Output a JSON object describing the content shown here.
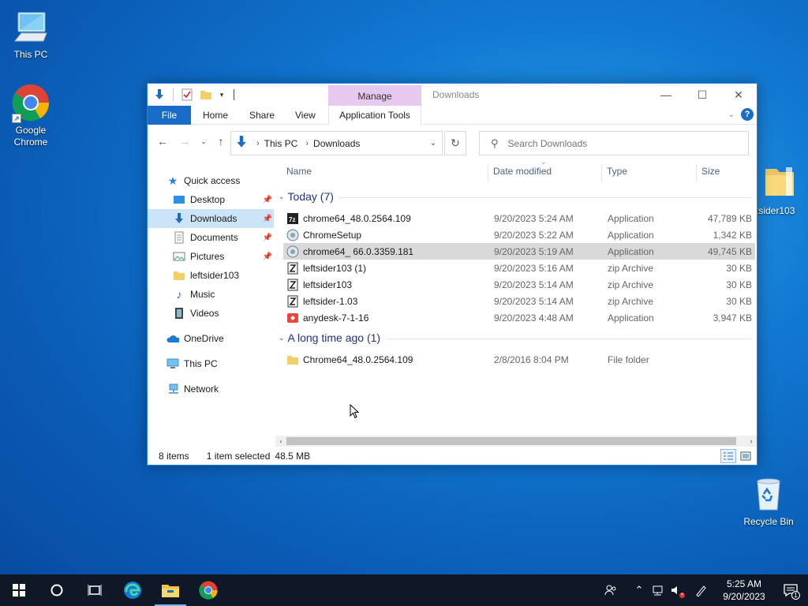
{
  "desktop": {
    "icons": [
      {
        "label": "This PC"
      },
      {
        "label": "Google Chrome"
      },
      {
        "label": "tsider103"
      },
      {
        "label": "Recycle Bin"
      }
    ]
  },
  "window": {
    "title": "Downloads",
    "manage_tab": "Manage",
    "ribbon": {
      "file": "File",
      "home": "Home",
      "share": "Share",
      "view": "View",
      "app_tools": "Application Tools"
    },
    "address": {
      "segments": [
        "This PC",
        "Downloads"
      ]
    },
    "search": {
      "placeholder": "Search Downloads"
    },
    "nav": {
      "quick_access": "Quick access",
      "items": [
        {
          "label": "Desktop",
          "pinned": true
        },
        {
          "label": "Downloads",
          "pinned": true,
          "selected": true
        },
        {
          "label": "Documents",
          "pinned": true
        },
        {
          "label": "Pictures",
          "pinned": true
        },
        {
          "label": "leftsider103"
        },
        {
          "label": "Music"
        },
        {
          "label": "Videos"
        }
      ],
      "onedrive": "OneDrive",
      "this_pc": "This PC",
      "network": "Network"
    },
    "columns": {
      "name": "Name",
      "date": "Date modified",
      "type": "Type",
      "size": "Size"
    },
    "groups": [
      {
        "label": "Today (7)",
        "rows": [
          {
            "name": "chrome64_48.0.2564.109",
            "date": "9/20/2023 5:24 AM",
            "type": "Application",
            "size": "47,789 KB",
            "icon": "7z-exe-icon"
          },
          {
            "name": "ChromeSetup",
            "date": "9/20/2023 5:22 AM",
            "type": "Application",
            "size": "1,342 KB",
            "icon": "installer-icon"
          },
          {
            "name": "chrome64_ 66.0.3359.181",
            "date": "9/20/2023 5:19 AM",
            "type": "Application",
            "size": "49,745 KB",
            "icon": "installer-icon",
            "selected": true
          },
          {
            "name": "leftsider103 (1)",
            "date": "9/20/2023 5:16 AM",
            "type": "zip Archive",
            "size": "30 KB",
            "icon": "zip-icon"
          },
          {
            "name": "leftsider103",
            "date": "9/20/2023 5:14 AM",
            "type": "zip Archive",
            "size": "30 KB",
            "icon": "zip-icon"
          },
          {
            "name": "leftsider-1.03",
            "date": "9/20/2023 5:14 AM",
            "type": "zip Archive",
            "size": "30 KB",
            "icon": "zip-icon"
          },
          {
            "name": "anydesk-7-1-16",
            "date": "9/20/2023 4:48 AM",
            "type": "Application",
            "size": "3,947 KB",
            "icon": "anydesk-icon"
          }
        ]
      },
      {
        "label": "A long time ago (1)",
        "rows": [
          {
            "name": "Chrome64_48.0.2564.109",
            "date": "2/8/2016 8:04 PM",
            "type": "File folder",
            "size": "",
            "icon": "folder-icon"
          }
        ]
      }
    ],
    "status": {
      "count": "8 items",
      "selected": "1 item selected",
      "size": "48.5 MB"
    }
  },
  "taskbar": {
    "time": "5:25 AM",
    "date": "9/20/2023",
    "notification_count": "1"
  }
}
